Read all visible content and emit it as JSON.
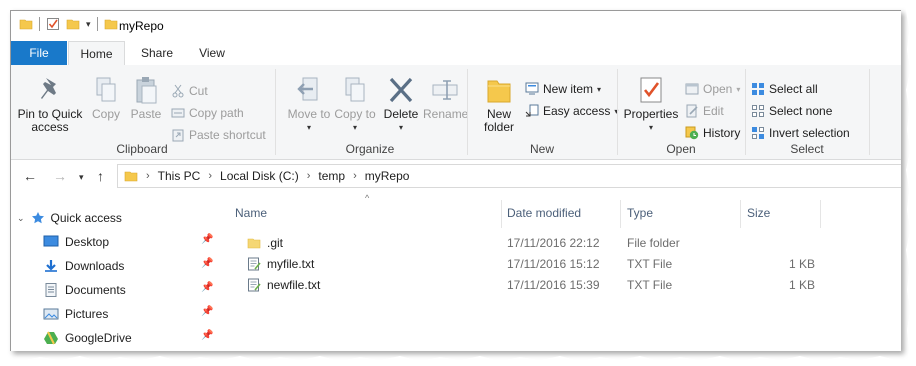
{
  "window": {
    "title": "myRepo"
  },
  "ribbon_tabs": [
    "File",
    "Home",
    "Share",
    "View"
  ],
  "clipboard": {
    "pin": "Pin to Quick access",
    "copy": "Copy",
    "paste": "Paste",
    "cut": "Cut",
    "copy_path": "Copy path",
    "paste_shortcut": "Paste shortcut",
    "label": "Clipboard"
  },
  "organize": {
    "move_to": "Move to",
    "copy_to": "Copy to",
    "delete": "Delete",
    "rename": "Rename",
    "label": "Organize"
  },
  "new_group": {
    "new_folder": "New folder",
    "new_item": "New item",
    "easy_access": "Easy access",
    "label": "New"
  },
  "open_group": {
    "properties": "Properties",
    "open": "Open",
    "edit": "Edit",
    "history": "History",
    "label": "Open"
  },
  "select_group": {
    "select_all": "Select all",
    "select_none": "Select none",
    "invert": "Invert selection",
    "label": "Select"
  },
  "breadcrumb": [
    "This PC",
    "Local Disk (C:)",
    "temp",
    "myRepo"
  ],
  "nav_pane": [
    {
      "label": "Quick access",
      "icon": "star-icon"
    },
    {
      "label": "Desktop",
      "icon": "desktop-icon"
    },
    {
      "label": "Downloads",
      "icon": "download-icon"
    },
    {
      "label": "Documents",
      "icon": "documents-icon"
    },
    {
      "label": "Pictures",
      "icon": "pictures-icon"
    },
    {
      "label": "GoogleDrive",
      "icon": "googledrive-icon"
    }
  ],
  "columns": {
    "name": "Name",
    "date": "Date modified",
    "type": "Type",
    "size": "Size"
  },
  "files": [
    {
      "name": ".git",
      "date": "17/11/2016 22:12",
      "type": "File folder",
      "size": ""
    },
    {
      "name": "myfile.txt",
      "date": "17/11/2016 15:12",
      "type": "TXT File",
      "size": "1 KB"
    },
    {
      "name": "newfile.txt",
      "date": "17/11/2016 15:39",
      "type": "TXT File",
      "size": "1 KB"
    }
  ],
  "colors": {
    "accent": "#1979ca",
    "folder": "#f5c84c",
    "header_text": "#4c607a"
  }
}
